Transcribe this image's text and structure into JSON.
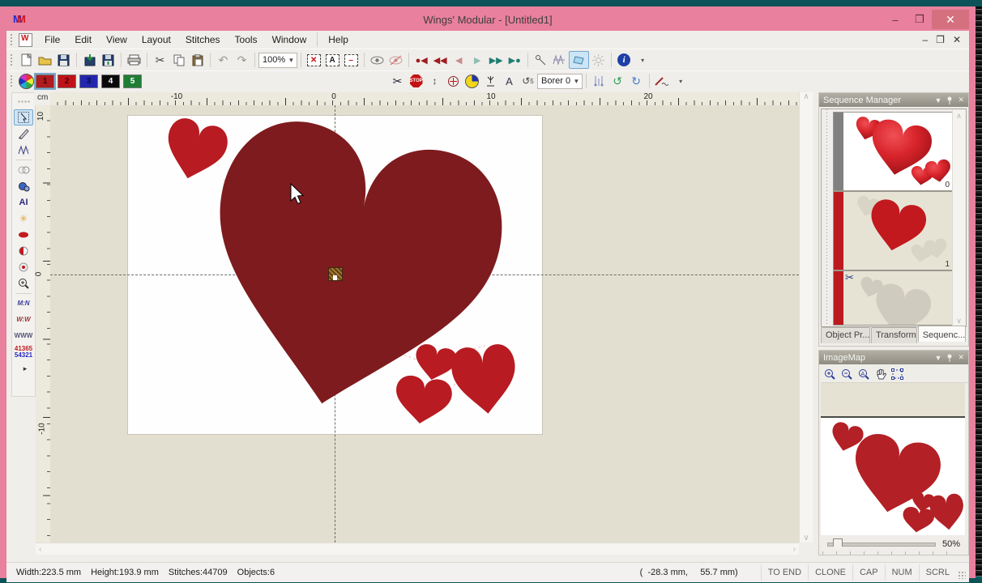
{
  "window": {
    "title": "Wings' Modular - [Untitled1]"
  },
  "menu": {
    "items": [
      "File",
      "Edit",
      "View",
      "Layout",
      "Stitches",
      "Tools",
      "Window",
      "Help"
    ]
  },
  "toolbar_main": {
    "zoom_value": "100%"
  },
  "toolbar_stitch": {
    "palette": [
      "1",
      "2",
      "3",
      "4",
      "5"
    ],
    "borer_label": "Borer 0"
  },
  "left_toolbar": {
    "ai_label": "AI",
    "mn_label": "M:N",
    "ww_label": "W:W",
    "www_label": "WWW",
    "badge_top": "41365",
    "badge_bottom": "54321"
  },
  "rulers": {
    "unit": "cm",
    "h_labels": [
      "-10",
      "0",
      "10",
      "20"
    ],
    "v_labels": [
      "10",
      "0",
      "-10"
    ]
  },
  "panels": {
    "sequence": {
      "title": "Sequence Manager",
      "items": [
        {
          "index": "0"
        },
        {
          "index": "1"
        },
        {
          "index": ""
        }
      ],
      "tabs": [
        "Object Pr...",
        "Transform",
        "Sequenc..."
      ]
    },
    "imagemap": {
      "title": "ImageMap",
      "zoom_label": "50%"
    }
  },
  "status_bar": {
    "width": "Width:223.5 mm",
    "height": "Height:193.9 mm",
    "stitches": "Stitches:44709",
    "objects": "Objects:6",
    "coords": "(  -28.3 mm,     55.7 mm)",
    "flags": [
      "TO END",
      "CLONE",
      "CAP",
      "NUM",
      "SCRL"
    ]
  },
  "icons": {
    "dropdown": "▾",
    "menu_arrow": "▼",
    "close": "✕",
    "minimize": "–",
    "restore": "❐",
    "maximize": "❒",
    "scissors": "✂",
    "undo": "↶",
    "redo": "↷",
    "left_arrow": "◀",
    "right_arrow": "▶",
    "up": "∧",
    "down": "∨",
    "left": "‹",
    "right": "›",
    "info": "i",
    "star": "✳",
    "letter_a": "A",
    "rotate_left": "↺",
    "rotate_right": "↻",
    "updown": "↕",
    "play": "▸"
  },
  "colors": {
    "titlebar_pink": "#E8809E",
    "teal_frame": "#0B5358",
    "heart_dark": "#7E1B1E",
    "heart_bright": "#B81B22",
    "palette": [
      "#AF1B1F",
      "#C01218",
      "#2326AE",
      "#0A0A0A",
      "#1F7E34"
    ]
  }
}
